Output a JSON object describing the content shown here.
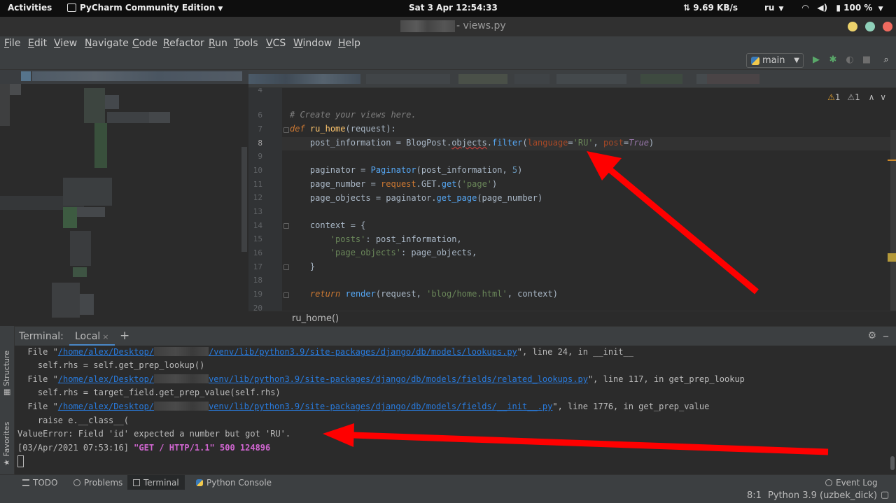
{
  "gnome": {
    "activities": "Activities",
    "app_name": "PyCharm Community Edition",
    "datetime": "Sat 3 Apr  12:54:33",
    "net_speed": "9.69 KB/s",
    "lang": "ru",
    "battery": "100 %"
  },
  "window": {
    "title": "- views.py"
  },
  "menu": {
    "file": "File",
    "edit": "Edit",
    "view": "View",
    "navigate": "Navigate",
    "code": "Code",
    "refactor": "Refactor",
    "run": "Run",
    "tools": "Tools",
    "vcs": "VCS",
    "window": "Window",
    "help": "Help"
  },
  "toolbar": {
    "run_config": "main"
  },
  "editor": {
    "inspection_warnings": "1",
    "inspection_weak": "1",
    "line_numbers": [
      "4",
      "6",
      "7",
      "8",
      "9",
      "10",
      "11",
      "12",
      "13",
      "14",
      "15",
      "16",
      "17",
      "18",
      "19",
      "20"
    ],
    "breadcrumb": "ru_home()",
    "code": {
      "l6_comment": "# Create your views here.",
      "l7_def": "def",
      "l7_name": "ru_home",
      "l7_open": "(",
      "l7_param": "request",
      "l7_close": "):",
      "l8_a": "    post_information = BlogPost.",
      "l8_objects": "objects",
      "l8_dot": ".",
      "l8_filter": "filter",
      "l8_open": "(",
      "l8_kw1": "language",
      "l8_eq1": "=",
      "l8_str": "'RU'",
      "l8_comma": ", ",
      "l8_kw2": "post",
      "l8_eq2": "=",
      "l8_true": "True",
      "l8_close": ")",
      "l10_a": "    paginator = ",
      "l10_call": "Paginator",
      "l10_b": "(post_information, ",
      "l10_num": "5",
      "l10_c": ")",
      "l11_a": "    page_number = ",
      "l11_req": "request",
      "l11_b": ".GET.",
      "l11_get": "get",
      "l11_c": "(",
      "l11_str": "'page'",
      "l11_d": ")",
      "l12_a": "    page_objects = paginator.",
      "l12_call": "get_page",
      "l12_b": "(page_number)",
      "l14": "    context = {",
      "l15_str": "'posts'",
      "l15_rest": ": post_information,",
      "l16_str": "'page_objects'",
      "l16_rest": ": page_objects,",
      "l17": "    }",
      "l19_kw": "return",
      "l19_call": "render",
      "l19_a": "(request, ",
      "l19_str": "'blog/home.html'",
      "l19_b": ", context)"
    }
  },
  "sidebar": {
    "structure": "Structure",
    "favorites": "Favorites"
  },
  "terminal": {
    "title": "Terminal:",
    "tab": "Local",
    "tab_close": "×",
    "add": "+",
    "lines": {
      "l1_pre": "  File \"",
      "l1_link_a": "/home/alex/Desktop/",
      "l1_link_b": "/venv/lib/python3.9/site-packages/django/db/models/lookups.py",
      "l1_post": "\", line 24, in __init__",
      "l2": "    self.rhs = self.get_prep_lookup()",
      "l3_pre": "  File \"",
      "l3_link_a": "/home/alex/Desktop/",
      "l3_link_b": "venv/lib/python3.9/site-packages/django/db/models/fields/related_lookups.py",
      "l3_post": "\", line 117, in get_prep_lookup",
      "l4": "    self.rhs = target_field.get_prep_value(self.rhs)",
      "l5_pre": "  File \"",
      "l5_link_a": "/home/alex/Desktop/",
      "l5_link_b": "venv/lib/python3.9/site-packages/django/db/models/fields/__init__.py",
      "l5_post": "\", line 1776, in get_prep_value",
      "l6": "    raise e.__class__(",
      "l7": "ValueError: Field 'id' expected a number but got 'RU'.",
      "l8_a": "[03/Apr/2021 07:53:16] ",
      "l8_b": "\"GET / HTTP/1.1\" 500 124896"
    }
  },
  "tools": {
    "todo": "TODO",
    "problems": "Problems",
    "terminal": "Terminal",
    "python_console": "Python Console",
    "event_log": "Event Log"
  },
  "status": {
    "position": "8:1",
    "interpreter": "Python 3.9 (uzbek_dick)"
  },
  "colors": {
    "accent": "#4a88c7",
    "annotation": "#ff0000",
    "editor_bg": "#2b2b2b",
    "panel_bg": "#3c3f41"
  }
}
